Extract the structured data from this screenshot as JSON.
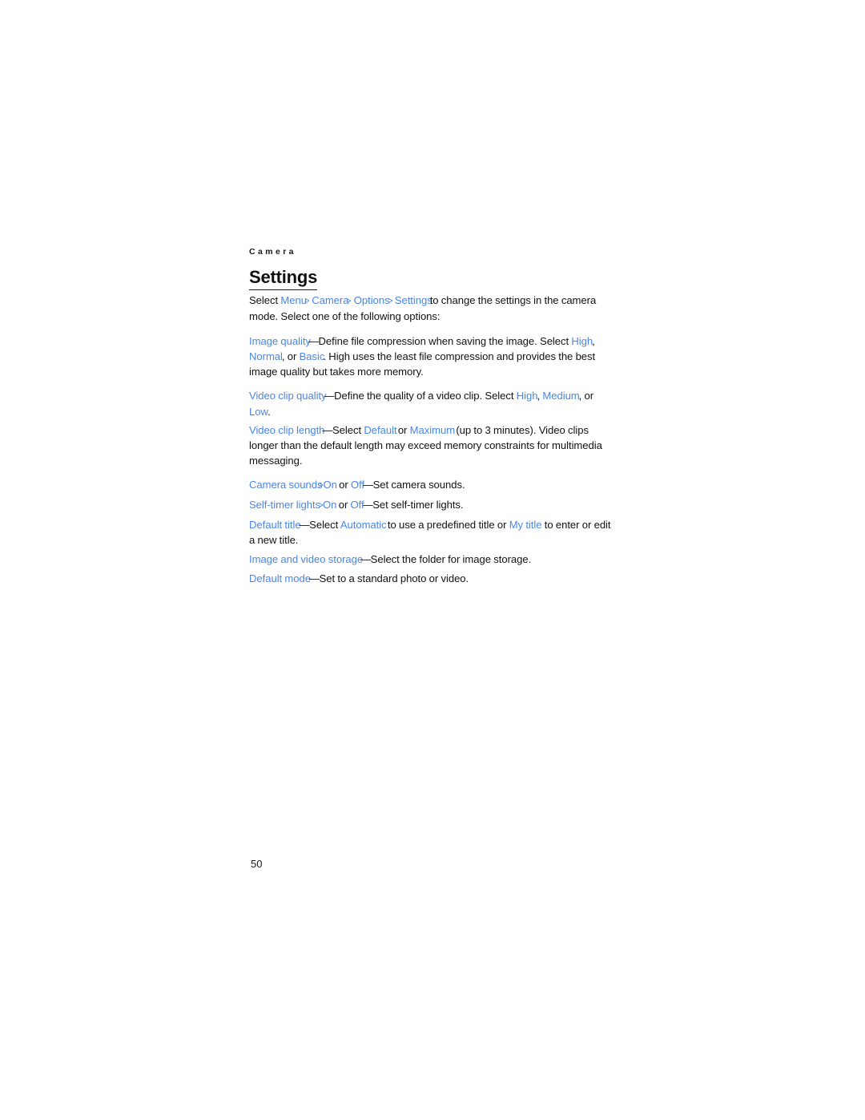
{
  "document": {
    "running_header": "Camera",
    "page_number": "50",
    "accent_color": "#4a86e8",
    "text_color": "#121212",
    "background_color": "#ffffff"
  },
  "heading": {
    "title": "Settings"
  },
  "paragraphs": {
    "intro": {
      "t1": "Select ",
      "kw1": "Menu",
      "s1": ">",
      "kw2": " Camera",
      "s2": ">",
      "kw3": " Options",
      "s3": ">",
      "kw4": " Settings",
      "t2": "to change the settings in the camera mode. Select one of the following options:"
    },
    "image_quality": {
      "term": "Image quality",
      "dash": "—",
      "t1": "Define file compression when saving the image. Select ",
      "kw1": "High",
      "t2": ", ",
      "kw2": "Normal",
      "t3": ", or ",
      "kw3": "Basic",
      "t4": ". High uses the least file compression and provides the best image quality but takes more memory."
    },
    "video_clip_quality": {
      "term": "Video clip quality",
      "dash": "—",
      "t1": "Define the quality of a video clip. Select ",
      "kw1": "High",
      "t2": ", ",
      "kw2": "Medium",
      "t3": ", or ",
      "kw3": "Low",
      "t4": "."
    },
    "video_clip_length": {
      "term": "Video clip length",
      "dash": "—",
      "t1": "Select ",
      "kw1": "Default",
      "t2": " or ",
      "kw2": "Maximum",
      "t3": " (up to 3 minutes). Video clips longer than the default length may exceed memory constraints for multimedia messaging."
    },
    "camera_sounds": {
      "term": "Camera sounds",
      "sep": ">",
      "kw1": "On",
      "t1": " or ",
      "kw2": "Off",
      "dash": "—",
      "t2": "Set camera sounds."
    },
    "self_timer_lights": {
      "term": "Self-timer lights",
      "sep": ">",
      "kw1": "On",
      "t1": " or ",
      "kw2": "Off",
      "dash": "—",
      "t2": "Set self-timer lights."
    },
    "default_title": {
      "term": "Default title",
      "dash": "—",
      "t1": "Select ",
      "kw1": "Automatic",
      "t2": " to use a predefined title or ",
      "kw2": "My title",
      "t3": " to enter or edit a new title."
    },
    "image_video_storage": {
      "term": "Image and video storage",
      "dash": "—",
      "t1": "Select the folder for image storage."
    },
    "default_mode": {
      "term": "Default mode",
      "dash": "—",
      "t1": "Set to a standard photo or video."
    }
  }
}
